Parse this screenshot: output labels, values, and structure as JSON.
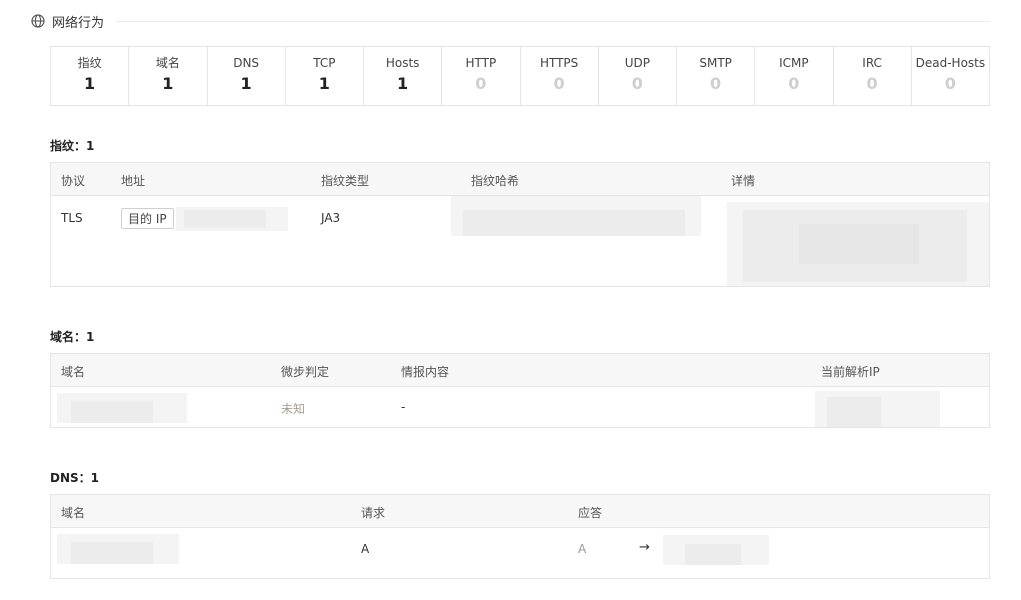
{
  "section": {
    "title": "网络行为",
    "icon": "globe-icon"
  },
  "stats": [
    {
      "label": "指纹",
      "value": "1"
    },
    {
      "label": "域名",
      "value": "1"
    },
    {
      "label": "DNS",
      "value": "1"
    },
    {
      "label": "TCP",
      "value": "1"
    },
    {
      "label": "Hosts",
      "value": "1"
    },
    {
      "label": "HTTP",
      "value": "0"
    },
    {
      "label": "HTTPS",
      "value": "0"
    },
    {
      "label": "UDP",
      "value": "0"
    },
    {
      "label": "SMTP",
      "value": "0"
    },
    {
      "label": "ICMP",
      "value": "0"
    },
    {
      "label": "IRC",
      "value": "0"
    },
    {
      "label": "Dead-Hosts",
      "value": "0"
    }
  ],
  "fingerprint": {
    "title": "指纹：1",
    "headers": [
      "协议",
      "地址",
      "指纹类型",
      "指纹哈希",
      "详情"
    ],
    "rows": [
      {
        "protocol": "TLS",
        "address_tag": "目的 IP",
        "type": "JA3"
      }
    ]
  },
  "domain": {
    "title": "域名：1",
    "headers": [
      "域名",
      "微步判定",
      "情报内容",
      "当前解析IP"
    ],
    "rows": [
      {
        "verdict": "未知",
        "intel": "-"
      }
    ]
  },
  "dns": {
    "title": "DNS：1",
    "headers": [
      "域名",
      "请求",
      "应答"
    ],
    "rows": [
      {
        "request": "A",
        "answer_type": "A",
        "arrow": "→"
      }
    ]
  }
}
